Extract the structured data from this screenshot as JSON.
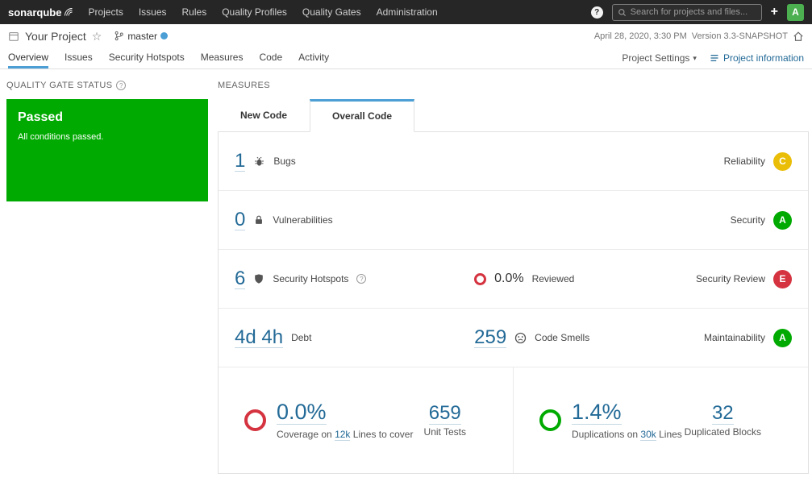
{
  "navbar": {
    "brand": "sonarqube",
    "items": [
      "Projects",
      "Issues",
      "Rules",
      "Quality Profiles",
      "Quality Gates",
      "Administration"
    ],
    "search_placeholder": "Search for projects and files...",
    "avatar_initial": "A"
  },
  "icons": {
    "help": "?",
    "star": "☆",
    "caret_down": "▾",
    "plus": "+"
  },
  "project_header": {
    "title": "Your Project",
    "branch": "master",
    "analysis_date": "April 28, 2020, 3:30 PM",
    "version": "Version 3.3-SNAPSHOT"
  },
  "project_nav": {
    "tabs": [
      "Overview",
      "Issues",
      "Security Hotspots",
      "Measures",
      "Code",
      "Activity"
    ],
    "active_tab": "Overview",
    "project_settings": "Project Settings",
    "project_information": "Project information"
  },
  "quality_gate": {
    "heading": "QUALITY GATE STATUS",
    "status": "Passed",
    "description": "All conditions passed."
  },
  "measures": {
    "heading": "MEASURES",
    "tabs": [
      "New Code",
      "Overall Code"
    ],
    "active_tab": "Overall Code",
    "rows": {
      "bugs": {
        "value": "1",
        "label": "Bugs",
        "rating_label": "Reliability",
        "rating": "C"
      },
      "vulnerabilities": {
        "value": "0",
        "label": "Vulnerabilities",
        "rating_label": "Security",
        "rating": "A"
      },
      "hotspots": {
        "value": "6",
        "label": "Security Hotspots",
        "reviewed_value": "0.0%",
        "reviewed_label": "Reviewed",
        "rating_label": "Security Review",
        "rating": "E"
      },
      "maintainability": {
        "debt_value": "4d 4h",
        "debt_label": "Debt",
        "smells_value": "259",
        "smells_label": "Code Smells",
        "rating_label": "Maintainability",
        "rating": "A"
      },
      "coverage": {
        "value": "0.0%",
        "label_prefix": "Coverage on",
        "lines_link": "12k",
        "label_suffix": "Lines to cover",
        "tests_value": "659",
        "tests_label": "Unit Tests"
      },
      "duplications": {
        "value": "1.4%",
        "label_prefix": "Duplications on",
        "lines_link": "30k",
        "label_suffix": "Lines",
        "blocks_value": "32",
        "blocks_label": "Duplicated Blocks"
      }
    },
    "colors": {
      "link_blue": "#236a97",
      "tab_accent_blue": "#4b9fd5",
      "passed_green": "#00aa00",
      "rating_a": "#00aa00",
      "rating_c": "#eabe06",
      "rating_e": "#d4333f",
      "navbar_dark": "#262626"
    }
  }
}
